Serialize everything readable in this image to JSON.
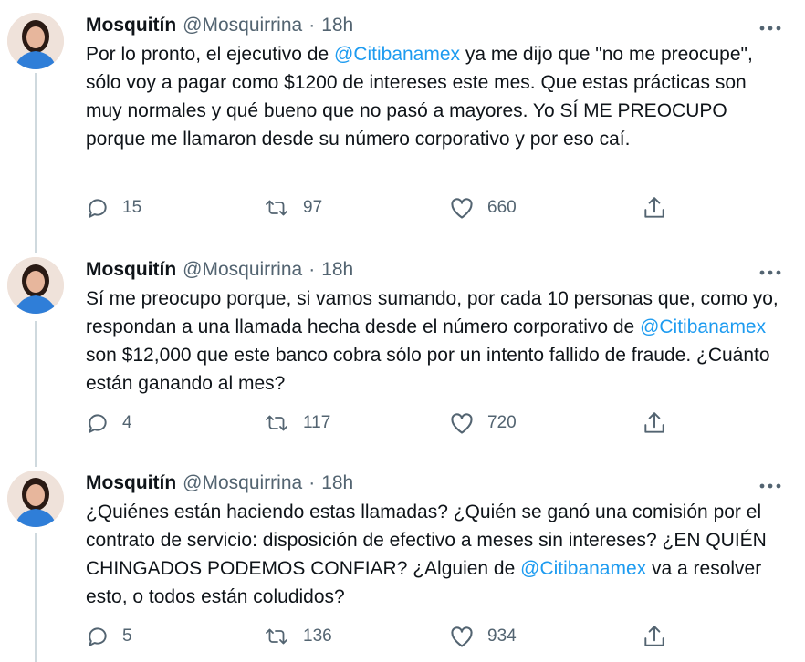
{
  "tweets": [
    {
      "author": {
        "name": "Mosquitín",
        "handle": "@Mosquirrina",
        "separator": "·",
        "time": "18h"
      },
      "body": {
        "p1": "Por lo pronto, el ejecutivo de ",
        "m1": "@Citibanamex",
        "p2": " ya me dijo que \"no me preocupe\", sólo voy a pagar como $1200 de intereses este mes. Que estas prácticas son muy normales y qué bueno que no pasó a mayores. Yo SÍ ME PREOCUPO porque me llamaron desde su número corporativo y por eso caí."
      },
      "stats": {
        "replies": "15",
        "retweets": "97",
        "likes": "660"
      }
    },
    {
      "author": {
        "name": "Mosquitín",
        "handle": "@Mosquirrina",
        "separator": "·",
        "time": "18h"
      },
      "body": {
        "p1": "Sí me preocupo porque, si vamos sumando, por cada 10 personas que, como yo, respondan a una llamada hecha desde el número corporativo de ",
        "m1": "@Citibanamex",
        "p2": " son $12,000 que este banco cobra sólo por un intento fallido de fraude. ¿Cuánto están ganando al mes?"
      },
      "stats": {
        "replies": "4",
        "retweets": "117",
        "likes": "720"
      }
    },
    {
      "author": {
        "name": "Mosquitín",
        "handle": "@Mosquirrina",
        "separator": "·",
        "time": "18h"
      },
      "body": {
        "p1": "¿Quiénes están haciendo estas llamadas? ¿Quién se ganó una comisión por el contrato de servicio: disposición de efectivo a meses sin intereses? ¿EN QUIÉN CHINGADOS PODEMOS CONFIAR? ¿Alguien de ",
        "m1": "@Citibanamex",
        "p2": " va a resolver esto, o todos están coludidos?"
      },
      "stats": {
        "replies": "5",
        "retweets": "136",
        "likes": "934"
      }
    }
  ],
  "icons": {
    "reply": "reply-icon",
    "retweet": "retweet-icon",
    "like": "heart-icon",
    "share": "share-icon",
    "more": "more-icon"
  },
  "colors": {
    "text": "#0f1419",
    "secondary": "#536471",
    "mention": "#1d9bf0",
    "thread_line": "#cfd9de"
  }
}
